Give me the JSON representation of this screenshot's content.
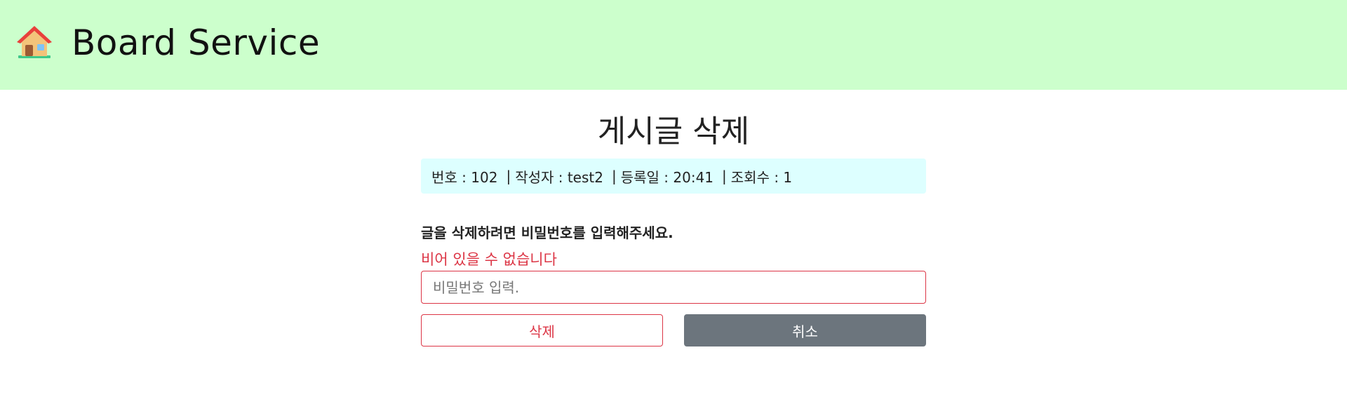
{
  "header": {
    "logo_icon": "house-icon",
    "brand": "Board Service",
    "background": "#ccffcc"
  },
  "page": {
    "title": "게시글 삭제"
  },
  "post_info": {
    "number_label": "번호 : 102",
    "author_label": "작성자 : test2",
    "date_label": "등록일 : 20:41",
    "views_label": "조회수 : 1",
    "separator": "|",
    "background": "#ddffff"
  },
  "form": {
    "prompt": "글을 삭제하려면 비밀번호를 입력해주세요.",
    "error": "비어 있을 수 없습니다",
    "password_placeholder": "비밀번호 입력.",
    "password_value": "",
    "error_color": "#dc3545"
  },
  "actions": {
    "delete_label": "삭제",
    "cancel_label": "취소",
    "cancel_color": "#6c757d"
  }
}
